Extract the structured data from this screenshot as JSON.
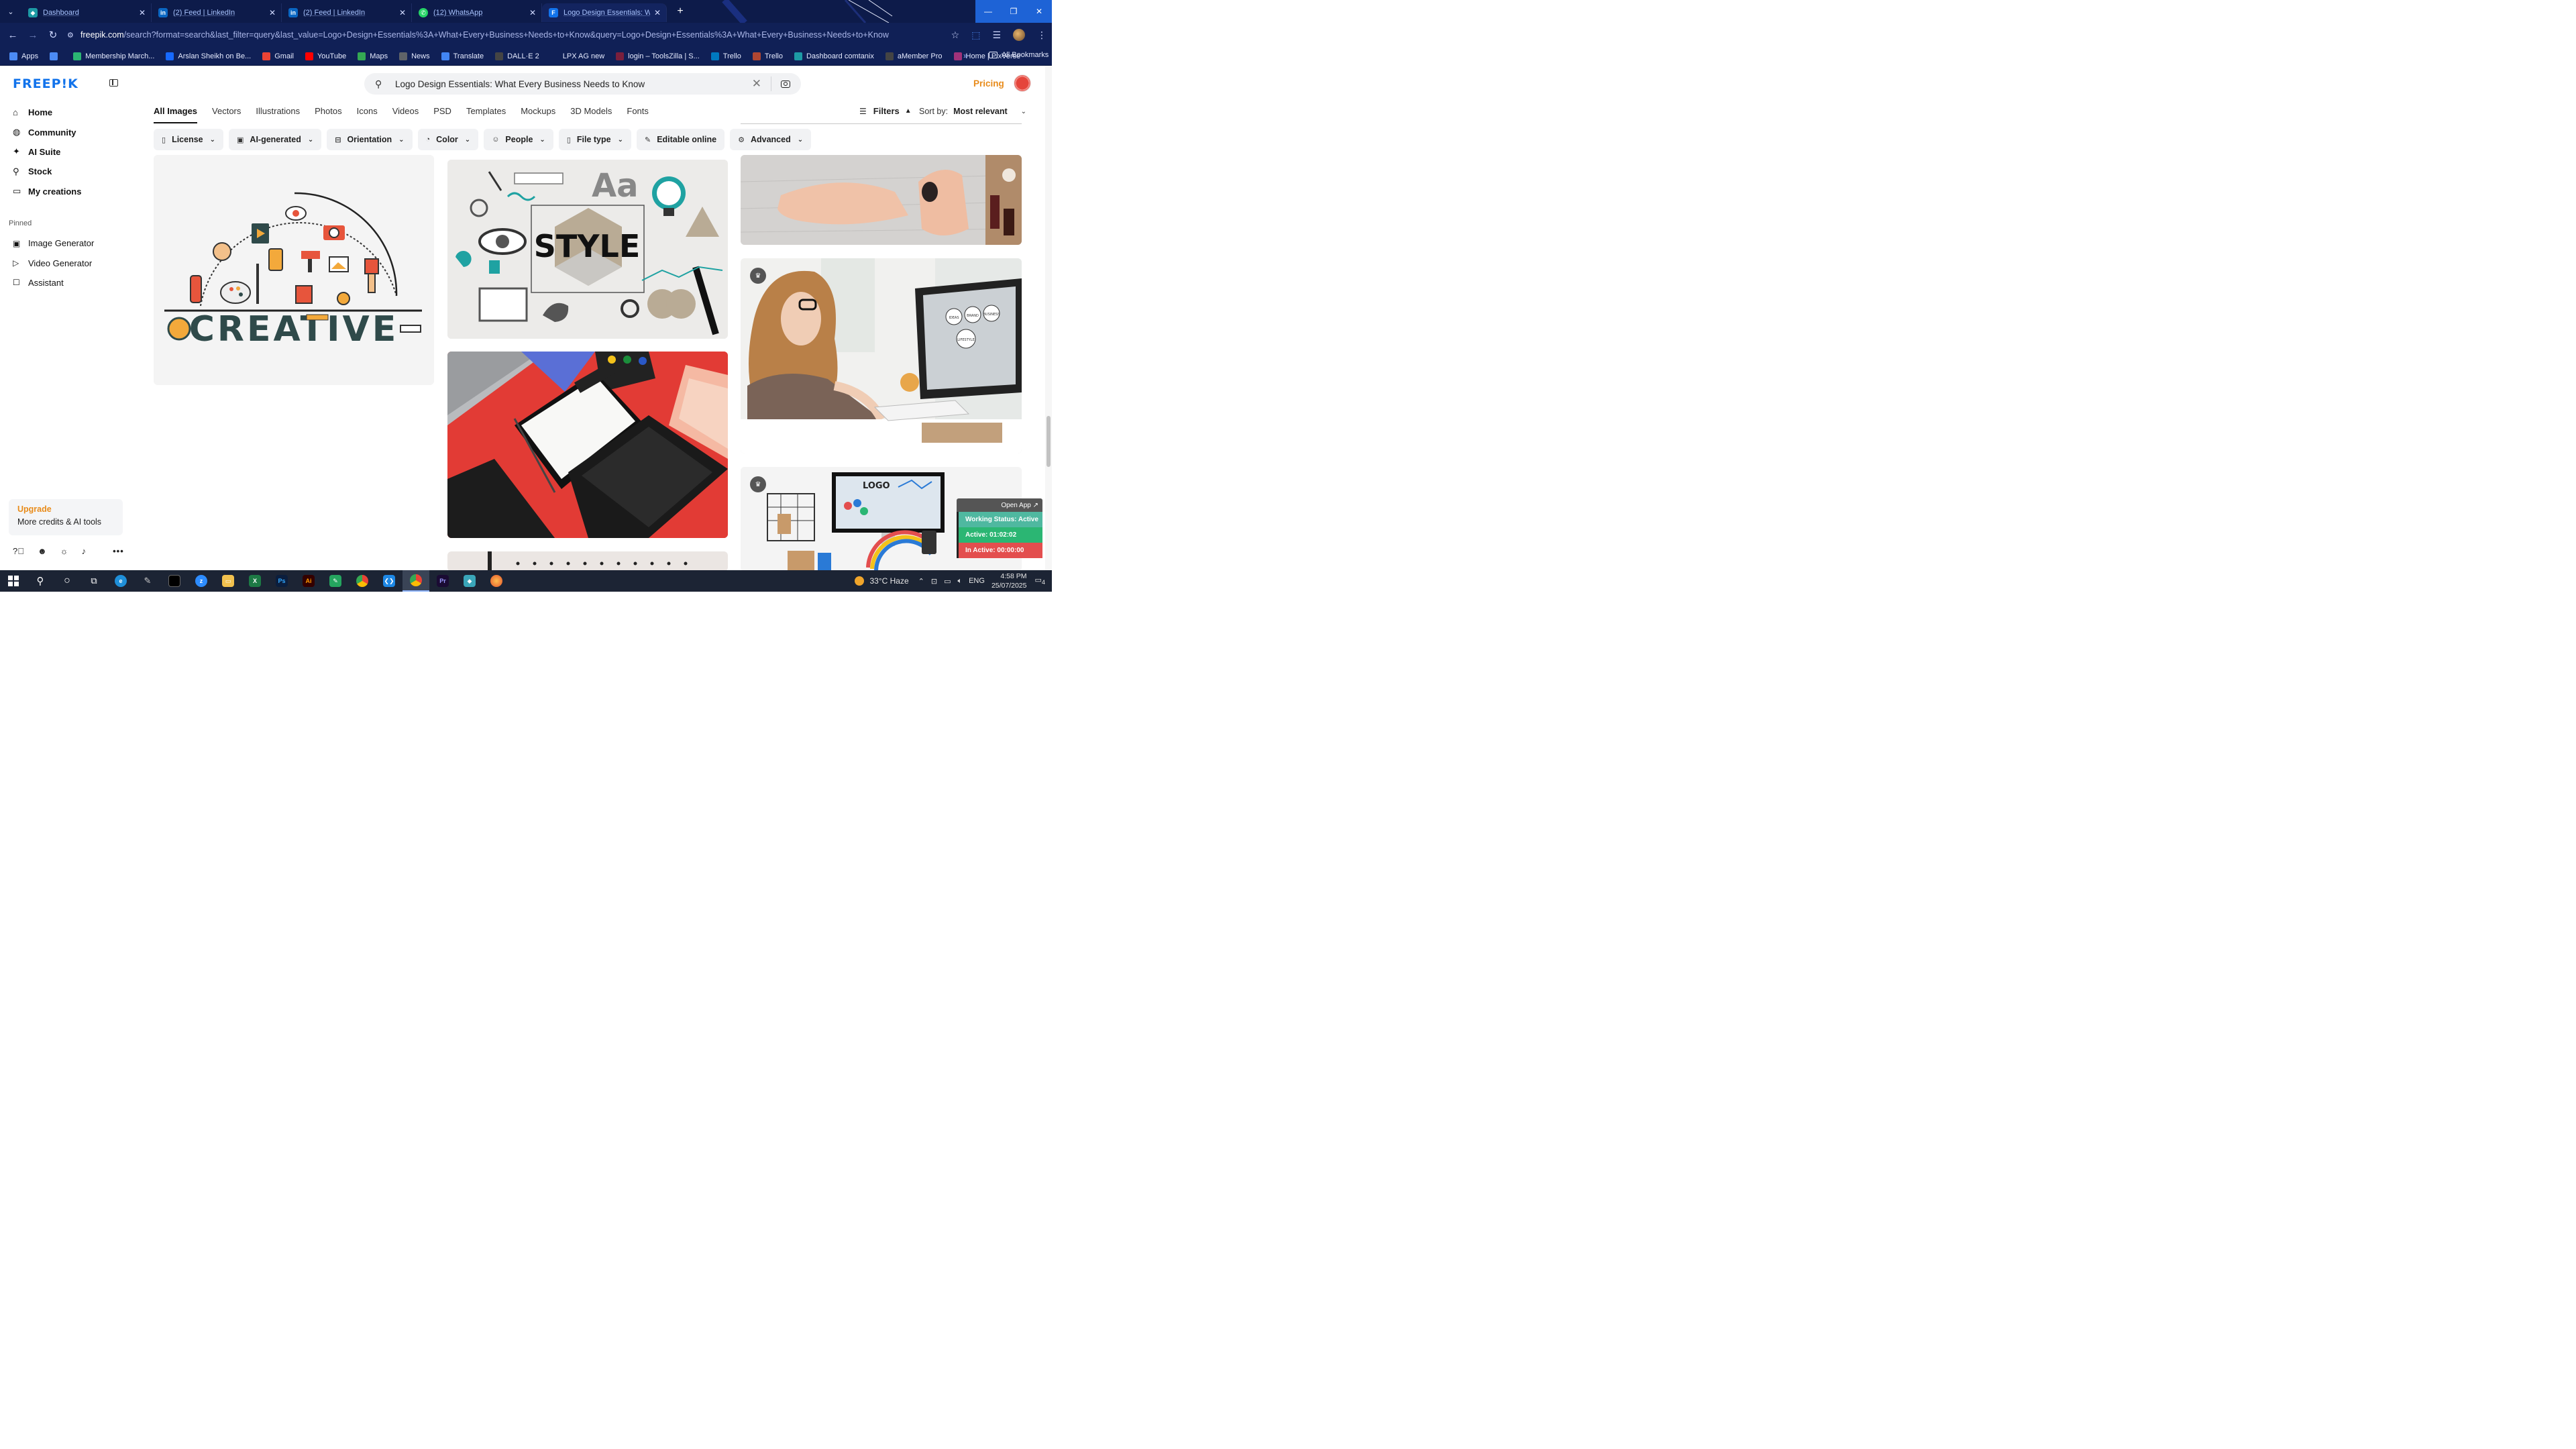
{
  "browser": {
    "tabs": [
      {
        "label": "Dashboard",
        "icon": "dashboard-icon",
        "color": "#1d9aa5"
      },
      {
        "label": "(2) Feed | LinkedIn",
        "icon": "linkedin-icon",
        "color": "#0a66c2"
      },
      {
        "label": "(2) Feed | LinkedIn",
        "icon": "linkedin-icon",
        "color": "#0a66c2"
      },
      {
        "label": "(12) WhatsApp",
        "icon": "whatsapp-icon",
        "color": "#25d366"
      },
      {
        "label": "Logo Design Essentials: What E",
        "icon": "freepik-icon",
        "color": "#1273eb"
      }
    ],
    "url_host": "freepik.com",
    "url_rest": "/search?format=search&last_filter=query&last_value=Logo+Design+Essentials%3A+What+Every+Business+Needs+to+Know&query=Logo+Design+Essentials%3A+What+Every+Business+Needs+to+Know",
    "bookmarks": [
      {
        "label": "Apps",
        "color": "#4c8bf5"
      },
      {
        "label": "",
        "color": "#4c8bf5"
      },
      {
        "label": "Membership March...",
        "color": "#2bb673"
      },
      {
        "label": "Arslan Sheikh on Be...",
        "color": "#1769ff"
      },
      {
        "label": "Gmail",
        "color": "#ea4335"
      },
      {
        "label": "YouTube",
        "color": "#ff0000"
      },
      {
        "label": "Maps",
        "color": "#34a853"
      },
      {
        "label": "News",
        "color": "#5f6368"
      },
      {
        "label": "Translate",
        "color": "#4285f4"
      },
      {
        "label": "DALL·E 2",
        "color": "#444444"
      },
      {
        "label": "LPX AG new",
        "color": "#102056"
      },
      {
        "label": "login – ToolsZilla | S...",
        "color": "#7a1f3d"
      },
      {
        "label": "Trello",
        "color": "#0079bf"
      },
      {
        "label": "Trello",
        "color": "#b04632"
      },
      {
        "label": "Dashboard comtanix",
        "color": "#1d9aa5"
      },
      {
        "label": "aMember Pro",
        "color": "#444444"
      },
      {
        "label": "Home | PixVerse",
        "color": "#a0327a"
      }
    ],
    "all_bookmarks": "All Bookmarks"
  },
  "sidebar": {
    "logo": "FREEP!K",
    "nav": [
      {
        "label": "Home",
        "icon": "home-icon"
      },
      {
        "label": "Community",
        "icon": "globe-icon"
      },
      {
        "label": "AI Suite",
        "icon": "sparkle-icon"
      },
      {
        "label": "Stock",
        "icon": "search-icon"
      },
      {
        "label": "My creations",
        "icon": "folder-icon"
      }
    ],
    "pinned_title": "Pinned",
    "pinned": [
      {
        "label": "Image Generator",
        "icon": "image-icon"
      },
      {
        "label": "Video Generator",
        "icon": "video-icon"
      },
      {
        "label": "Assistant",
        "icon": "chat-icon"
      }
    ],
    "upgrade_title": "Upgrade",
    "upgrade_sub": "More credits & AI tools"
  },
  "header": {
    "search_value": "Logo Design Essentials: What Every Business Needs to Know",
    "pricing": "Pricing"
  },
  "type_tabs": [
    "All Images",
    "Vectors",
    "Illustrations",
    "Photos",
    "Icons",
    "Videos",
    "PSD",
    "Templates",
    "Mockups",
    "3D Models",
    "Fonts"
  ],
  "filters_label": "Filters",
  "sort": {
    "label": "Sort by:",
    "value": "Most relevant"
  },
  "chips": [
    {
      "label": "License",
      "icon": "license-icon"
    },
    {
      "label": "AI-generated",
      "icon": "ai-icon"
    },
    {
      "label": "Orientation",
      "icon": "orientation-icon"
    },
    {
      "label": "Color",
      "icon": "palette-icon"
    },
    {
      "label": "People",
      "icon": "people-icon"
    },
    {
      "label": "File type",
      "icon": "file-icon"
    },
    {
      "label": "Editable online",
      "icon": "pen-icon"
    },
    {
      "label": "Advanced",
      "icon": "gear-icon"
    }
  ],
  "images": {
    "creative_word": "CREATIVE",
    "style_word": "STYLE",
    "aa_text": "Aa",
    "logo_text": "LOGO",
    "monitor_badges": [
      "IDEAS",
      "BRAND",
      "BUSINESS",
      "LIFESTYLE"
    ]
  },
  "widget": {
    "open": "Open App ↗",
    "status": "Working Status: Active",
    "active": "Active: 01:02:02",
    "inactive": "In Active: 00:00:00"
  },
  "taskbar": {
    "weather": "33°C  Haze",
    "lang": "ENG",
    "time": "4:58 PM",
    "date": "25/07/2025",
    "notifications": "4"
  }
}
